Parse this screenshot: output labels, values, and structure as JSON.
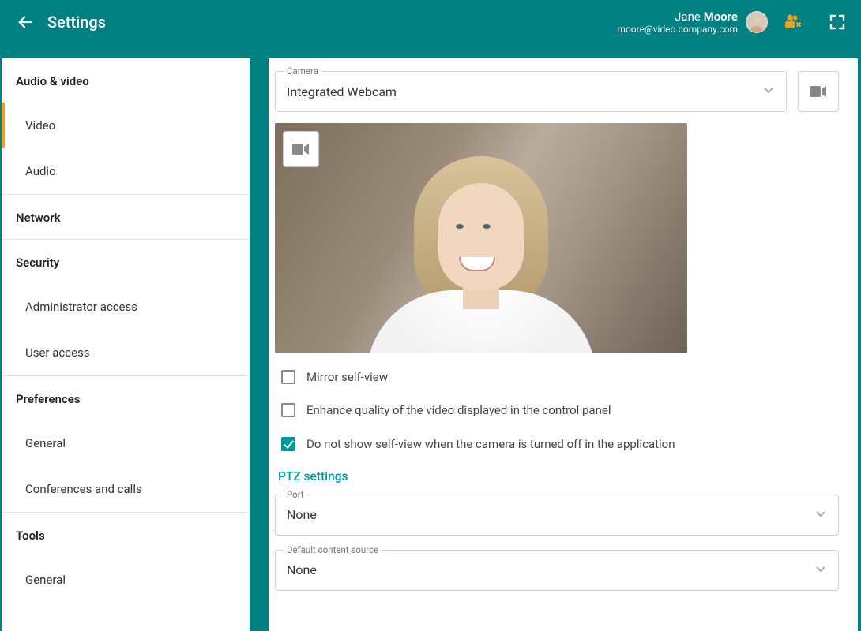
{
  "header": {
    "title": "Settings",
    "user": {
      "first": "Jane",
      "last": "Moore",
      "email": "moore@video.company.com"
    }
  },
  "sidebar": {
    "groups": [
      {
        "title": "Audio & video",
        "items": [
          "Video",
          "Audio"
        ],
        "active": 0
      },
      {
        "title": "Network",
        "items": []
      },
      {
        "title": "Security",
        "items": [
          "Administrator access",
          "User access"
        ]
      },
      {
        "title": "Preferences",
        "items": [
          "General",
          "Conferences and calls"
        ]
      },
      {
        "title": "Tools",
        "items": [
          "General"
        ]
      }
    ]
  },
  "main": {
    "camera": {
      "label": "Camera",
      "value": "Integrated Webcam"
    },
    "checks": [
      {
        "label": "Mirror self-view",
        "checked": false
      },
      {
        "label": "Enhance quality of the video displayed in the control panel",
        "checked": false
      },
      {
        "label": "Do not show self-view when the camera is turned off in the application",
        "checked": true
      }
    ],
    "ptz_title": "PTZ settings",
    "port": {
      "label": "Port",
      "value": "None"
    },
    "source": {
      "label": "Default content source",
      "value": "None"
    }
  }
}
